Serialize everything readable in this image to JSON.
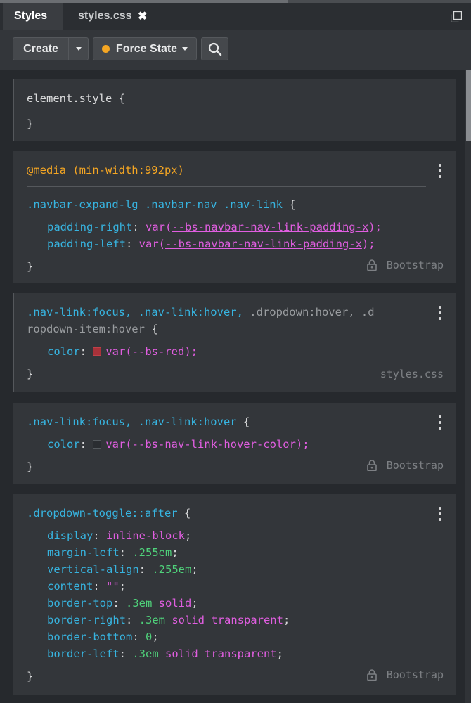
{
  "tabs": [
    {
      "label": "Styles"
    },
    {
      "label": "styles.css",
      "close": "✖"
    }
  ],
  "toolbar": {
    "create_label": "Create",
    "force_state_label": "Force State",
    "force_state_dot_color": "#f5a623"
  },
  "rules": [
    {
      "selector": "element.style {",
      "close": "}"
    },
    {
      "media": "@media (min-width:992px)",
      "selector": ".navbar-expand-lg .navbar-nav .nav-link",
      "open": "{",
      "decls": [
        {
          "prop": "padding-right",
          "fn": "var(",
          "var": "--bs-navbar-nav-link-padding-x",
          "end": ");"
        },
        {
          "prop": "padding-left",
          "fn": "var(",
          "var": "--bs-navbar-nav-link-padding-x",
          "end": ");"
        }
      ],
      "close": "}",
      "origin": "Bootstrap"
    },
    {
      "selector_line1_a": ".nav-link:focus, .nav-link:hover,",
      "selector_line1_b": ".dropdown:hover, .d",
      "selector_line2": "ropdown-item:hover",
      "open": "{",
      "decls": [
        {
          "prop": "color",
          "fn": "var(",
          "var": "--bs-red",
          "end": ");",
          "swatch": "#a8323a"
        }
      ],
      "close": "}",
      "origin": "styles.css"
    },
    {
      "selector": ".nav-link:focus, .nav-link:hover",
      "open": "{",
      "decls": [
        {
          "prop": "color",
          "fn": "var(",
          "var": "--bs-nav-link-hover-color",
          "end": ");"
        }
      ],
      "close": "}",
      "origin": "Bootstrap"
    },
    {
      "selector": ".dropdown-toggle::after",
      "open": "{",
      "decls": [
        {
          "prop": "display",
          "value": "inline-block"
        },
        {
          "prop": "margin-left",
          "value": ".255em"
        },
        {
          "prop": "vertical-align",
          "value": ".255em"
        },
        {
          "prop": "content",
          "value": "\"\""
        },
        {
          "prop": "border-top",
          "value_num": ".3em",
          "value_kw": "solid"
        },
        {
          "prop": "border-right",
          "value_num": ".3em",
          "value_kw": "solid transparent"
        },
        {
          "prop": "border-bottom",
          "value": "0"
        },
        {
          "prop": "border-left",
          "value_num": ".3em",
          "value_kw": "solid transparent"
        }
      ],
      "close": "}",
      "origin": "Bootstrap"
    }
  ]
}
